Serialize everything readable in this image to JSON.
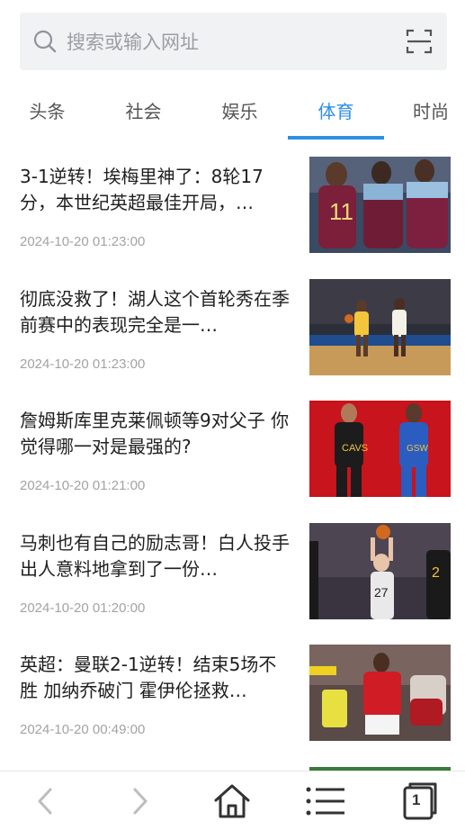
{
  "search": {
    "placeholder": "搜索或输入网址",
    "search_icon": "search-icon",
    "scan_icon": "scan-icon"
  },
  "tabs": [
    {
      "label": "头条",
      "active": false
    },
    {
      "label": "社会",
      "active": false
    },
    {
      "label": "娱乐",
      "active": false
    },
    {
      "label": "体育",
      "active": true
    },
    {
      "label": "时尚",
      "active": false
    }
  ],
  "articles": [
    {
      "title": "3-1逆转！埃梅里神了：8轮17分，本世纪英超最佳开局，…",
      "time": "2024-10-20 01:23:00",
      "image": "soccer-celebration-photo"
    },
    {
      "title": "彻底没救了！湖人这个首轮秀在季前赛中的表现完全是一…",
      "time": "2024-10-20 01:23:00",
      "image": "basketball-game-photo"
    },
    {
      "title": "詹姆斯库里克莱佩顿等9对父子 你觉得哪一对是最强的?",
      "time": "2024-10-20 01:21:00",
      "image": "basketball-players-red-background-photo"
    },
    {
      "title": "马刺也有自己的励志哥！白人投手出人意料地拿到了一份…",
      "time": "2024-10-20 01:20:00",
      "image": "basketball-shooter-photo"
    },
    {
      "title": "英超：曼联2-1逆转！结束5场不胜 加纳乔破门 霍伊伦拯救…",
      "time": "2024-10-20 00:49:00",
      "image": "manchester-united-celebration-photo"
    }
  ],
  "bottom_nav": {
    "tab_count": "1",
    "icons": [
      "back-icon",
      "forward-icon",
      "home-icon",
      "menu-icon",
      "tabs-icon"
    ]
  },
  "colors": {
    "accent": "#2f8fe3",
    "search_bg": "#f1f2f4",
    "timestamp": "#a3a3a3"
  }
}
